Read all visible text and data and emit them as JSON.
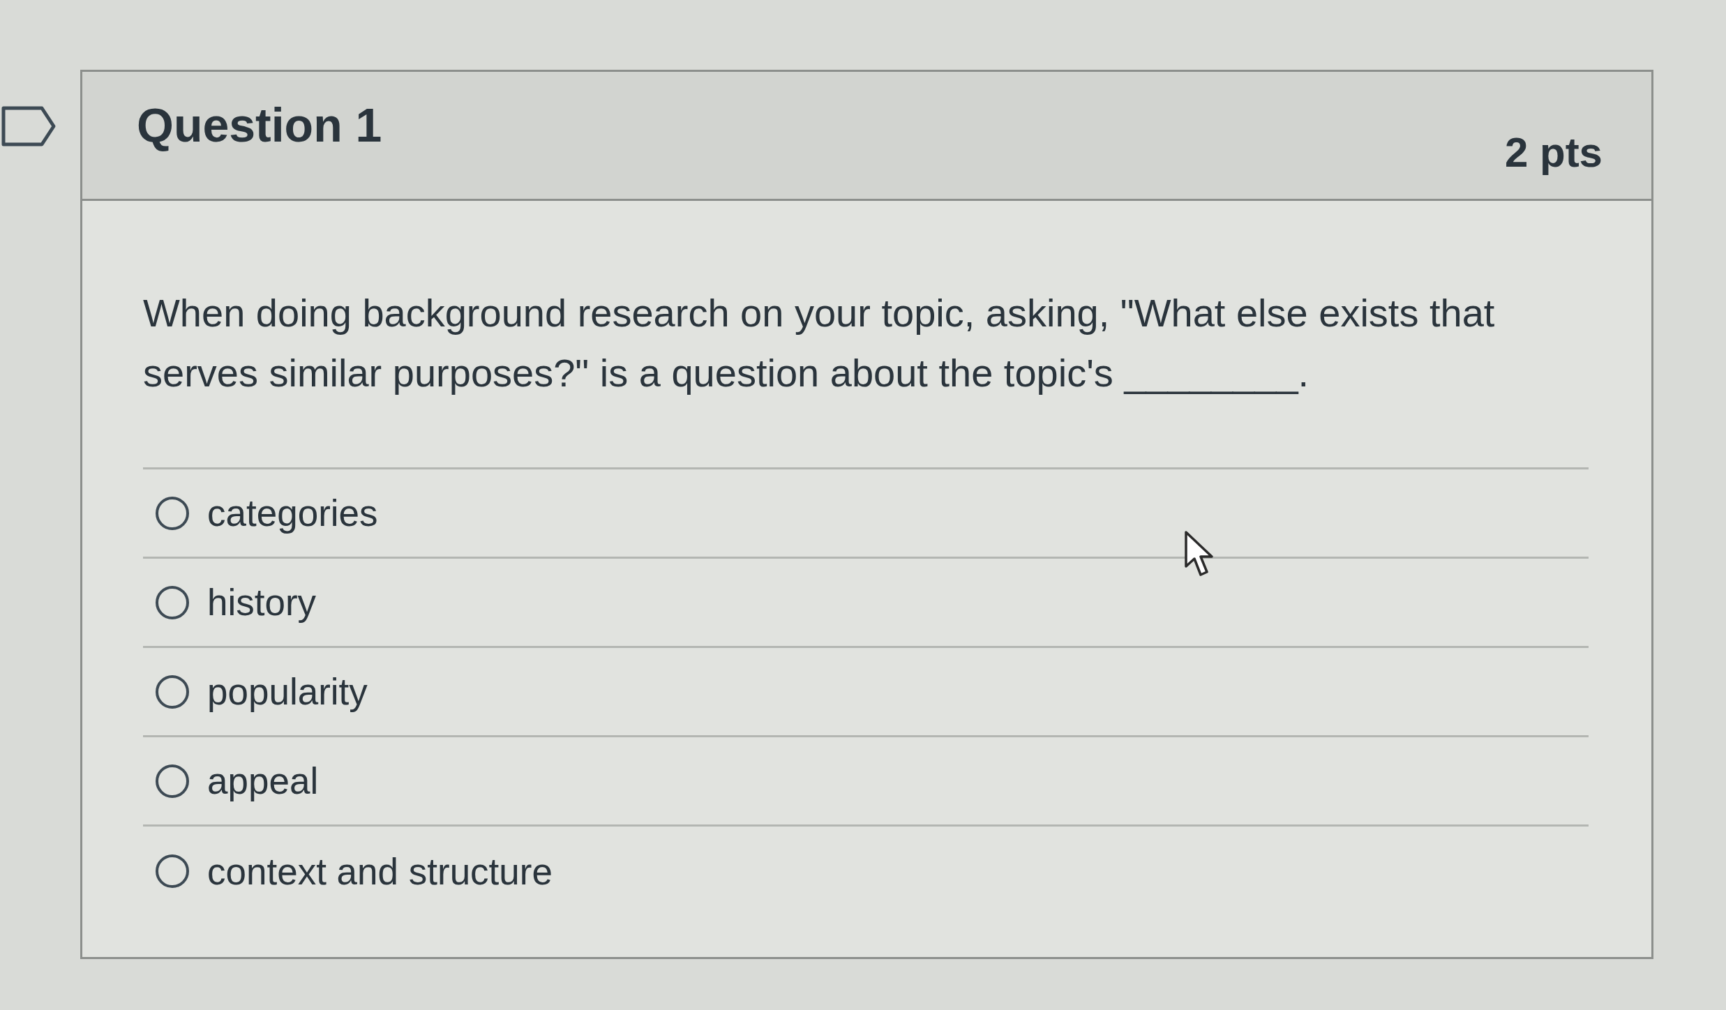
{
  "question": {
    "title": "Question 1",
    "points": "2 pts",
    "text": "When doing background research on your topic, asking, \"What else exists that serves similar purposes?\" is a question about the topic's ________.",
    "answers": [
      {
        "label": "categories",
        "selected": false
      },
      {
        "label": "history",
        "selected": false
      },
      {
        "label": "popularity",
        "selected": false
      },
      {
        "label": "appeal",
        "selected": false
      },
      {
        "label": "context and structure",
        "selected": false
      }
    ]
  }
}
